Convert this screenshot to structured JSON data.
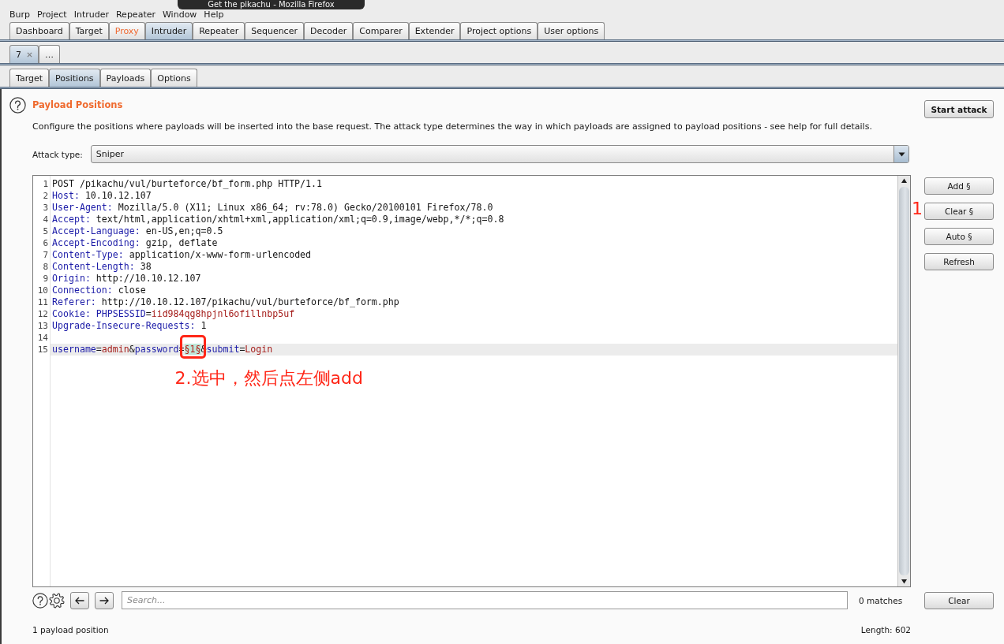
{
  "menu": [
    "Burp",
    "Project",
    "Intruder",
    "Repeater",
    "Window",
    "Help"
  ],
  "tooltip": {
    "text": "Get the pikachu - Mozilla Firefox"
  },
  "tabs": [
    {
      "label": "Dashboard",
      "selected": false,
      "highlighted": false
    },
    {
      "label": "Target",
      "selected": false,
      "highlighted": false
    },
    {
      "label": "Proxy",
      "selected": false,
      "highlighted": true
    },
    {
      "label": "Intruder",
      "selected": true,
      "highlighted": false
    },
    {
      "label": "Repeater",
      "selected": false,
      "highlighted": false
    },
    {
      "label": "Sequencer",
      "selected": false,
      "highlighted": false
    },
    {
      "label": "Decoder",
      "selected": false,
      "highlighted": false
    },
    {
      "label": "Comparer",
      "selected": false,
      "highlighted": false
    },
    {
      "label": "Extender",
      "selected": false,
      "highlighted": false
    },
    {
      "label": "Project options",
      "selected": false,
      "highlighted": false
    },
    {
      "label": "User options",
      "selected": false,
      "highlighted": false
    }
  ],
  "request_tabs": [
    {
      "label": "7",
      "selected": true,
      "closable": true
    },
    {
      "label": "…",
      "selected": false,
      "closable": false
    }
  ],
  "intruder_tabs": [
    {
      "label": "Target",
      "selected": false
    },
    {
      "label": "Positions",
      "selected": true
    },
    {
      "label": "Payloads",
      "selected": false
    },
    {
      "label": "Options",
      "selected": false
    }
  ],
  "positions": {
    "title": "Payload Positions",
    "description": "Configure the positions where payloads will be inserted into the base request. The attack type determines the way in which payloads are assigned to payload positions - see help for full details.",
    "start_button": "Start attack",
    "attack_type": {
      "label": "Attack type:",
      "value": "Sniper"
    }
  },
  "editor": {
    "lines": [
      {
        "number": "1",
        "current": false,
        "segments": [
          {
            "kind": "text",
            "text": "POST /pikachu/vul/burteforce/bf_form.php HTTP/1.1"
          }
        ]
      },
      {
        "number": "2",
        "current": false,
        "segments": [
          {
            "kind": "key",
            "text": "Host:"
          },
          {
            "kind": "text",
            "text": " 10.10.12.107"
          }
        ]
      },
      {
        "number": "3",
        "current": false,
        "segments": [
          {
            "kind": "key",
            "text": "User-Agent:"
          },
          {
            "kind": "text",
            "text": " Mozilla/5.0 (X11; Linux x86_64; rv:78.0) Gecko/20100101 Firefox/78.0"
          }
        ]
      },
      {
        "number": "4",
        "current": false,
        "segments": [
          {
            "kind": "key",
            "text": "Accept:"
          },
          {
            "kind": "text",
            "text": " text/html,application/xhtml+xml,application/xml;q=0.9,image/webp,*/*;q=0.8"
          }
        ]
      },
      {
        "number": "5",
        "current": false,
        "segments": [
          {
            "kind": "key",
            "text": "Accept-Language:"
          },
          {
            "kind": "text",
            "text": " en-US,en;q=0.5"
          }
        ]
      },
      {
        "number": "6",
        "current": false,
        "segments": [
          {
            "kind": "key",
            "text": "Accept-Encoding:"
          },
          {
            "kind": "text",
            "text": " gzip, deflate"
          }
        ]
      },
      {
        "number": "7",
        "current": false,
        "segments": [
          {
            "kind": "key",
            "text": "Content-Type:"
          },
          {
            "kind": "text",
            "text": " application/x-www-form-urlencoded"
          }
        ]
      },
      {
        "number": "8",
        "current": false,
        "segments": [
          {
            "kind": "key",
            "text": "Content-Length:"
          },
          {
            "kind": "text",
            "text": " 38"
          }
        ]
      },
      {
        "number": "9",
        "current": false,
        "segments": [
          {
            "kind": "key",
            "text": "Origin:"
          },
          {
            "kind": "text",
            "text": " http://10.10.12.107"
          }
        ]
      },
      {
        "number": "10",
        "current": false,
        "segments": [
          {
            "kind": "key",
            "text": "Connection:"
          },
          {
            "kind": "text",
            "text": " close"
          }
        ]
      },
      {
        "number": "11",
        "current": false,
        "segments": [
          {
            "kind": "key",
            "text": "Referer:"
          },
          {
            "kind": "text",
            "text": " http://10.10.12.107/pikachu/vul/burteforce/bf_form.php"
          }
        ]
      },
      {
        "number": "12",
        "current": false,
        "segments": [
          {
            "kind": "key",
            "text": "Cookie:"
          },
          {
            "kind": "key",
            "text": " PHPSESSID"
          },
          {
            "kind": "text",
            "text": "="
          },
          {
            "kind": "value",
            "text": "iid984qg8hpjnl6ofillnbp5uf"
          }
        ]
      },
      {
        "number": "13",
        "current": false,
        "segments": [
          {
            "kind": "key",
            "text": "Upgrade-Insecure-Requests:"
          },
          {
            "kind": "text",
            "text": " 1"
          }
        ]
      },
      {
        "number": "14",
        "current": false
      },
      {
        "number": "15",
        "current": true,
        "segments": [
          {
            "kind": "key",
            "text": "username"
          },
          {
            "kind": "text",
            "text": "="
          },
          {
            "kind": "value",
            "text": "admin"
          },
          {
            "kind": "text",
            "text": "&"
          },
          {
            "kind": "key",
            "text": "password"
          },
          {
            "kind": "text",
            "text": "="
          },
          {
            "kind": "payload",
            "text": "§1§",
            "circled": true
          },
          {
            "kind": "text",
            "text": "&"
          },
          {
            "kind": "key",
            "text": "submit"
          },
          {
            "kind": "text",
            "text": "="
          },
          {
            "kind": "value",
            "text": "Login"
          }
        ]
      }
    ]
  },
  "side_buttons": [
    "Add §",
    "Clear §",
    "Auto §",
    "Refresh"
  ],
  "annotations": [
    {
      "kind": "step",
      "text": "1"
    },
    {
      "kind": "note",
      "text": "2.选中，然后点左侧add"
    }
  ],
  "search": {
    "placeholder": "Search...",
    "matches": "0 matches",
    "clear_button": "Clear"
  },
  "status_bar": {
    "positions": "1 payload position",
    "length": "Length: 602"
  }
}
